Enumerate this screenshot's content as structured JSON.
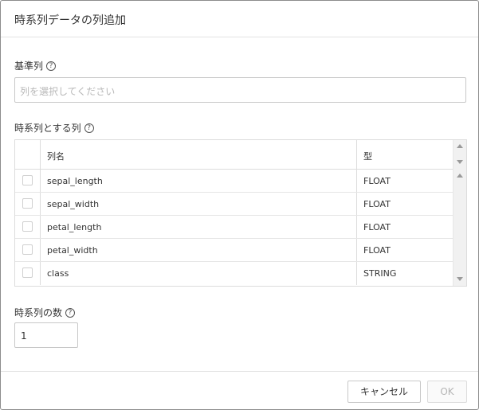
{
  "dialog": {
    "title": "時系列データの列追加"
  },
  "base_column": {
    "label": "基準列",
    "help": "?",
    "placeholder": "列を選択してください"
  },
  "series_columns": {
    "label": "時系列とする列",
    "help": "?",
    "headers": {
      "name": "列名",
      "type": "型"
    },
    "rows": [
      {
        "name": "sepal_length",
        "type": "FLOAT",
        "checked": false
      },
      {
        "name": "sepal_width",
        "type": "FLOAT",
        "checked": false
      },
      {
        "name": "petal_length",
        "type": "FLOAT",
        "checked": false
      },
      {
        "name": "petal_width",
        "type": "FLOAT",
        "checked": false
      },
      {
        "name": "class",
        "type": "STRING",
        "checked": false
      }
    ]
  },
  "series_count": {
    "label": "時系列の数",
    "help": "?",
    "value": "1"
  },
  "footer": {
    "cancel_label": "キャンセル",
    "ok_label": "OK"
  },
  "colors": {
    "border": "#8c8c8c",
    "text": "#333333",
    "placeholder": "#b8b8b8",
    "disabled_text": "#b5b5b5"
  }
}
